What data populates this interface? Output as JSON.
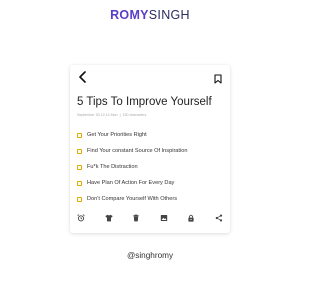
{
  "brand": {
    "first": "ROMY",
    "last": "SINGH"
  },
  "note": {
    "title": "5 Tips To Improve Yourself",
    "meta_date": "September 30 12:14 Mon",
    "meta_sep": "|",
    "meta_count": "150 characters",
    "items": [
      {
        "text": "Get Your Priorities Right",
        "checked": false
      },
      {
        "text": "Find Your constant Source Of  Inspiration",
        "checked": false
      },
      {
        "text": "Fu*k The Distraction",
        "checked": false
      },
      {
        "text": "Have Plan Of Action For Every Day",
        "checked": false
      },
      {
        "text": "Don't Compare Yourself With Others",
        "checked": false
      }
    ]
  },
  "toolbar": {
    "icons": [
      "alarm-icon",
      "shirt-icon",
      "trash-icon",
      "image-icon",
      "lock-icon",
      "share-icon"
    ]
  },
  "footer": {
    "handle": "@singhromy"
  },
  "colors": {
    "brand_accent": "#5a3ec8",
    "brand_dark": "#2b2b5e",
    "checkbox": "#e0a800"
  }
}
